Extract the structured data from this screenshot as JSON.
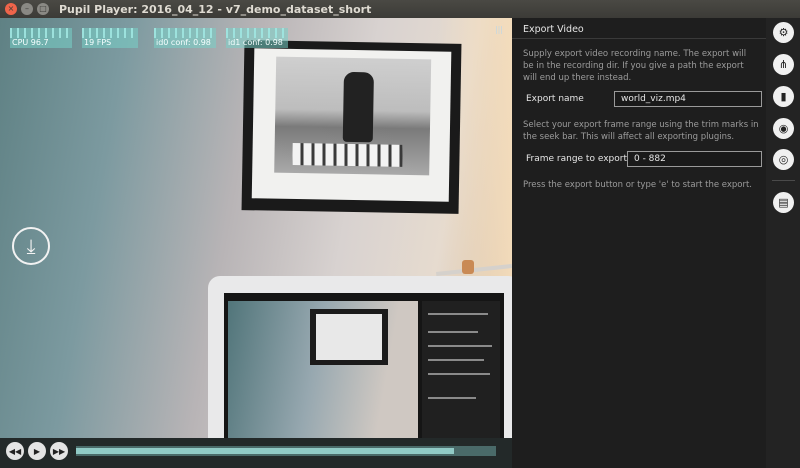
{
  "window": {
    "title": "Pupil Player: 2016_04_12 - v7_demo_dataset_short",
    "close_glyph": "×",
    "minimize_glyph": "–",
    "maximize_glyph": "□"
  },
  "overlay": {
    "cpu": "CPU 96.7",
    "fps": "19 FPS",
    "id0": "id0 conf: 0.98",
    "id1": "id1 conf: 0.98"
  },
  "playback": {
    "seek_progress": 0.9,
    "buttons": [
      {
        "name": "rewind-icon",
        "glyph": "◀◀"
      },
      {
        "name": "play-icon",
        "glyph": "▶"
      },
      {
        "name": "fast-forward-icon",
        "glyph": "▶▶"
      }
    ]
  },
  "export_panel": {
    "title": "Export Video",
    "intro": "Supply export video recording name. The export will be in the recording dir. If you give a path the export will end up there instead.",
    "name_label": "Export name",
    "name_value": "world_viz.mp4",
    "range_help": "Select your export frame range using the trim marks in the seek bar. This will affect all exporting plugins.",
    "range_label": "Frame range to export",
    "range_value": "0 - 882",
    "footer": "Press the export button or type 'e' to start the export."
  },
  "icon_bar": [
    {
      "name": "settings-gear-icon",
      "glyph": "⚙"
    },
    {
      "name": "plugin-manager-icon",
      "glyph": "⋔"
    },
    {
      "name": "bar-chart-icon",
      "glyph": "▮"
    },
    {
      "name": "eye-icon",
      "glyph": "◉"
    },
    {
      "name": "target-icon",
      "glyph": "◎"
    },
    {
      "name": "export-document-icon",
      "glyph": "▤"
    }
  ],
  "download_glyph": "⤓"
}
